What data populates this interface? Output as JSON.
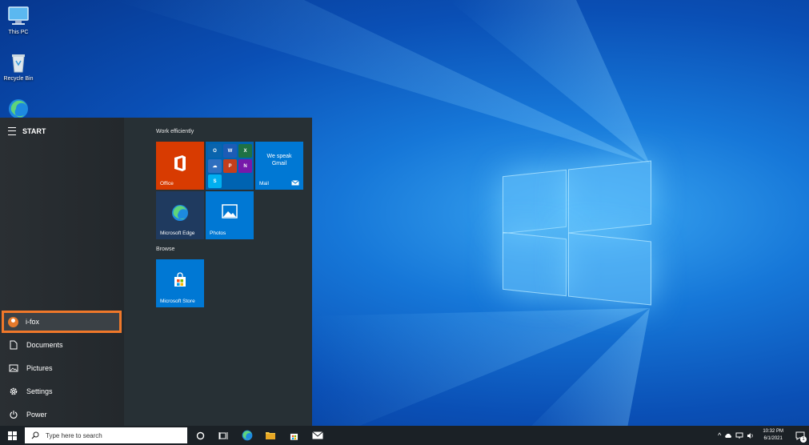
{
  "desktop": {
    "icons": [
      {
        "label": "This PC",
        "icon": "computer-icon"
      },
      {
        "label": "Recycle Bin",
        "icon": "recycle-bin-icon"
      },
      {
        "label": "",
        "icon": "edge-icon"
      }
    ]
  },
  "start_menu": {
    "title": "START",
    "user_name": "i-fox",
    "left_items": [
      {
        "label": "Documents",
        "icon": "document-icon"
      },
      {
        "label": "Pictures",
        "icon": "pictures-icon"
      },
      {
        "label": "Settings",
        "icon": "gear-icon"
      },
      {
        "label": "Power",
        "icon": "power-icon"
      }
    ],
    "sections": [
      {
        "title": "Work efficiently",
        "tiles": [
          {
            "label": "Office",
            "color": "#d83b01"
          },
          {
            "label": "",
            "color": "#0063b1"
          },
          {
            "label": "Mail",
            "color": "#0078d4",
            "text": "We speak Gmail"
          },
          {
            "label": "Microsoft Edge",
            "color": "#1f3a5f"
          },
          {
            "label": "Photos",
            "color": "#0078d4"
          }
        ]
      },
      {
        "title": "Browse",
        "tiles": [
          {
            "label": "Microsoft Store",
            "color": "#0078d4"
          }
        ]
      }
    ]
  },
  "taskbar": {
    "search_placeholder": "Type here to search",
    "time": "10:32 PM",
    "date": "6/1/2021",
    "notification_count": "1"
  },
  "colors": {
    "highlight": "#f0782a",
    "start_bg": "#252b2f",
    "taskbar_bg": "#1b2126"
  }
}
